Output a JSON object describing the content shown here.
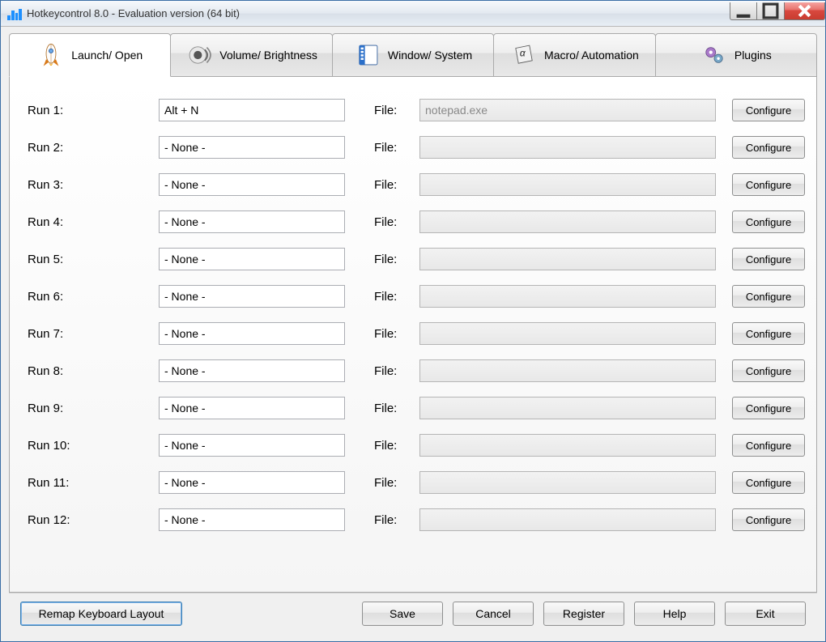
{
  "window": {
    "title": "Hotkeycontrol 8.0 - Evaluation version (64 bit)"
  },
  "tabs": [
    {
      "label": "Launch/ Open",
      "active": true
    },
    {
      "label": "Volume/ Brightness",
      "active": false
    },
    {
      "label": "Window/ System",
      "active": false
    },
    {
      "label": "Macro/ Automation",
      "active": false
    },
    {
      "label": "Plugins",
      "active": false
    }
  ],
  "labels": {
    "run_prefix": "Run",
    "file": "File:",
    "configure": "Configure"
  },
  "rows": [
    {
      "n": 1,
      "hotkey": "Alt + N",
      "file": "notepad.exe"
    },
    {
      "n": 2,
      "hotkey": "- None -",
      "file": ""
    },
    {
      "n": 3,
      "hotkey": "- None -",
      "file": ""
    },
    {
      "n": 4,
      "hotkey": "- None -",
      "file": ""
    },
    {
      "n": 5,
      "hotkey": "- None -",
      "file": ""
    },
    {
      "n": 6,
      "hotkey": "- None -",
      "file": ""
    },
    {
      "n": 7,
      "hotkey": "- None -",
      "file": ""
    },
    {
      "n": 8,
      "hotkey": "- None -",
      "file": ""
    },
    {
      "n": 9,
      "hotkey": "- None -",
      "file": ""
    },
    {
      "n": 10,
      "hotkey": "- None -",
      "file": ""
    },
    {
      "n": 11,
      "hotkey": "- None -",
      "file": ""
    },
    {
      "n": 12,
      "hotkey": "- None -",
      "file": ""
    }
  ],
  "buttons": {
    "remap": "Remap Keyboard Layout",
    "save": "Save",
    "cancel": "Cancel",
    "register": "Register",
    "help": "Help",
    "exit": "Exit"
  }
}
